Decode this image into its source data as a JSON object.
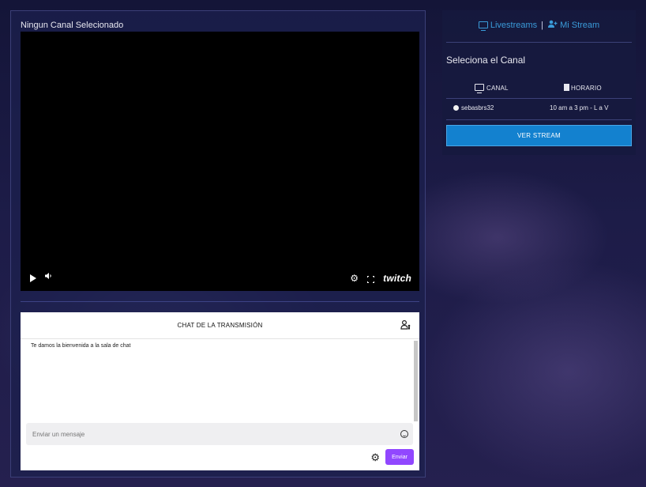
{
  "player_section": {
    "channel_title": "Ningun Canal Selecionado",
    "logo_text": "twitch"
  },
  "chat": {
    "header_title": "CHAT DE LA TRANSMISIÓN",
    "welcome_message": "Te damos la bienvenida a la sala de chat",
    "input_placeholder": "Enviar un mensaje",
    "send_label": "Enviar"
  },
  "sidebar": {
    "links": [
      {
        "label": "Livestreams",
        "icon": "monitor-icon"
      },
      {
        "label": "Mi Stream",
        "icon": "user-plus-icon"
      }
    ],
    "separator": "|",
    "select_title": "Seleciona el Canal",
    "table": {
      "columns": [
        {
          "label": "CANAL",
          "icon": "monitor-icon"
        },
        {
          "label": "HORARIO",
          "icon": "calendar-icon"
        }
      ],
      "rows": [
        {
          "channel": "sebasbrs32",
          "schedule": "10 am a 3 pm - L a V"
        }
      ]
    },
    "button_label": "VER STREAM"
  },
  "colors": {
    "link": "#3a9bd9",
    "button": "#1381cf",
    "send_button": "#9147ff"
  }
}
